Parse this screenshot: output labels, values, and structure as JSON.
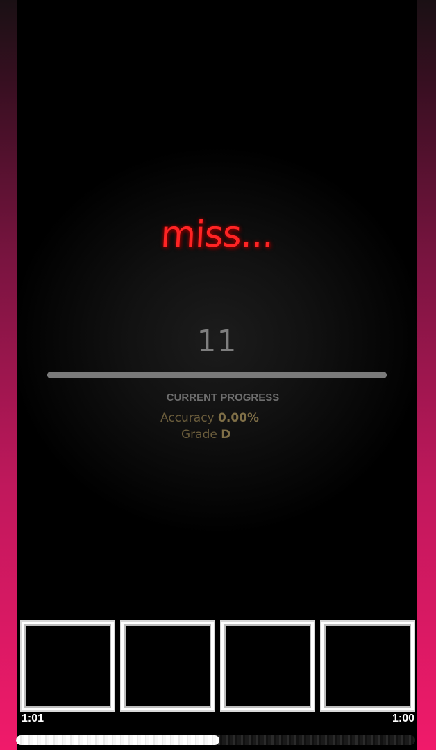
{
  "colors": {
    "side_gradient_top": "#1a1014",
    "side_gradient_bottom": "#f01a6a",
    "judgement": "#ff2424",
    "combo": "#7e7e7e",
    "stats": "#6b5d3c",
    "lane_border": "#ffffff"
  },
  "judgement": {
    "text": "miss..."
  },
  "combo": {
    "value": "11"
  },
  "progress": {
    "fill_fraction": 1.0,
    "label": "CURRENT PROGRESS"
  },
  "stats": {
    "accuracy_label": "Accuracy",
    "accuracy_value": "0.00%",
    "grade_label": "Grade",
    "grade_value": "D"
  },
  "lanes": [
    {
      "id": "lane-1"
    },
    {
      "id": "lane-2"
    },
    {
      "id": "lane-3"
    },
    {
      "id": "lane-4"
    }
  ],
  "playback": {
    "elapsed": "1:01",
    "remaining": "1:00",
    "played_fraction": 0.51
  }
}
